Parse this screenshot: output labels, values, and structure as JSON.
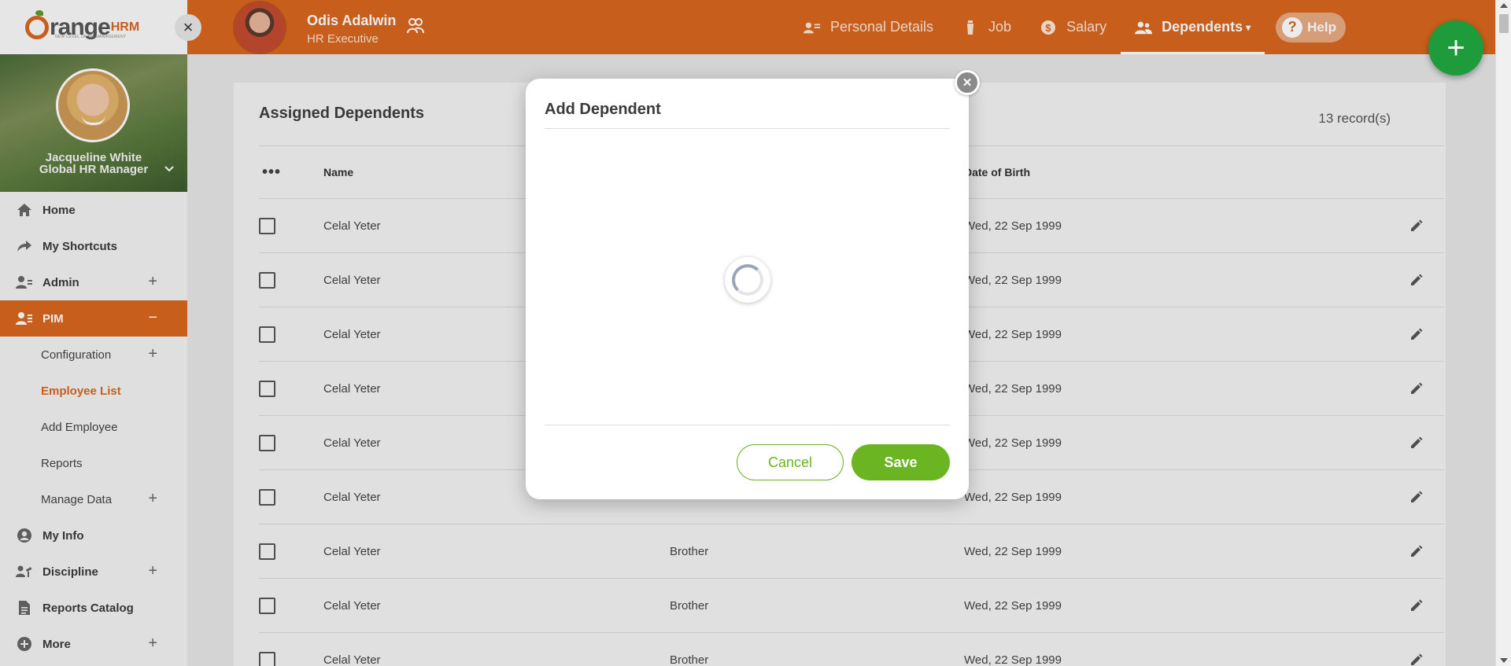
{
  "logo": {
    "text": "range",
    "hrm": "HRM",
    "tagline": "NEW LEVEL OF HR MANAGEMENT"
  },
  "sidebar": {
    "user_name": "Jacqueline White",
    "user_role": "Global HR Manager",
    "items": [
      {
        "label": "Home",
        "icon": "home-icon",
        "expandable": false
      },
      {
        "label": "My Shortcuts",
        "icon": "share-arrow-icon",
        "expandable": false
      },
      {
        "label": "Admin",
        "icon": "admin-user-icon",
        "expandable": true
      },
      {
        "label": "PIM",
        "icon": "pim-card-icon",
        "expandable": true,
        "active": true
      },
      {
        "label": "Configuration",
        "sub": true,
        "expandable": true
      },
      {
        "label": "Employee List",
        "sub": true,
        "current": true
      },
      {
        "label": "Add Employee",
        "sub": true
      },
      {
        "label": "Reports",
        "sub": true
      },
      {
        "label": "Manage Data",
        "sub": true,
        "expandable": true
      },
      {
        "label": "My Info",
        "icon": "person-circle-icon"
      },
      {
        "label": "Discipline",
        "icon": "gavel-icon",
        "expandable": true
      },
      {
        "label": "Reports Catalog",
        "icon": "document-icon"
      },
      {
        "label": "More",
        "icon": "plus-circle-icon",
        "expandable": true
      }
    ]
  },
  "header": {
    "employee_name": "Odis Adalwin",
    "employee_role": "HR Executive",
    "tabs": [
      {
        "label": "Personal Details",
        "icon": "id-card-icon"
      },
      {
        "label": "Job",
        "icon": "briefcase-icon"
      },
      {
        "label": "Salary",
        "icon": "dollar-circle-icon"
      },
      {
        "label": "Dependents",
        "icon": "people-icon",
        "active": true
      }
    ],
    "help_label": "Help"
  },
  "content": {
    "title": "Assigned Dependents",
    "records": "13 record(s)",
    "columns": [
      "Name",
      "",
      "Date of Birth"
    ],
    "rows": [
      {
        "name": "Celal Yeter",
        "relationship": "",
        "dob": "Wed, 22 Sep 1999"
      },
      {
        "name": "Celal Yeter",
        "relationship": "",
        "dob": "Wed, 22 Sep 1999"
      },
      {
        "name": "Celal Yeter",
        "relationship": "",
        "dob": "Wed, 22 Sep 1999"
      },
      {
        "name": "Celal Yeter",
        "relationship": "",
        "dob": "Wed, 22 Sep 1999"
      },
      {
        "name": "Celal Yeter",
        "relationship": "",
        "dob": "Wed, 22 Sep 1999"
      },
      {
        "name": "Celal Yeter",
        "relationship": "",
        "dob": "Wed, 22 Sep 1999"
      },
      {
        "name": "Celal Yeter",
        "relationship": "Brother",
        "dob": "Wed, 22 Sep 1999"
      },
      {
        "name": "Celal Yeter",
        "relationship": "Brother",
        "dob": "Wed, 22 Sep 1999"
      },
      {
        "name": "Celal Yeter",
        "relationship": "Brother",
        "dob": "Wed, 22 Sep 1999"
      }
    ]
  },
  "modal": {
    "title": "Add Dependent",
    "cancel_label": "Cancel",
    "save_label": "Save"
  },
  "colors": {
    "brand_orange": "#d8661f",
    "save_green": "#6bb522",
    "fab_green": "#1e9b3a"
  }
}
